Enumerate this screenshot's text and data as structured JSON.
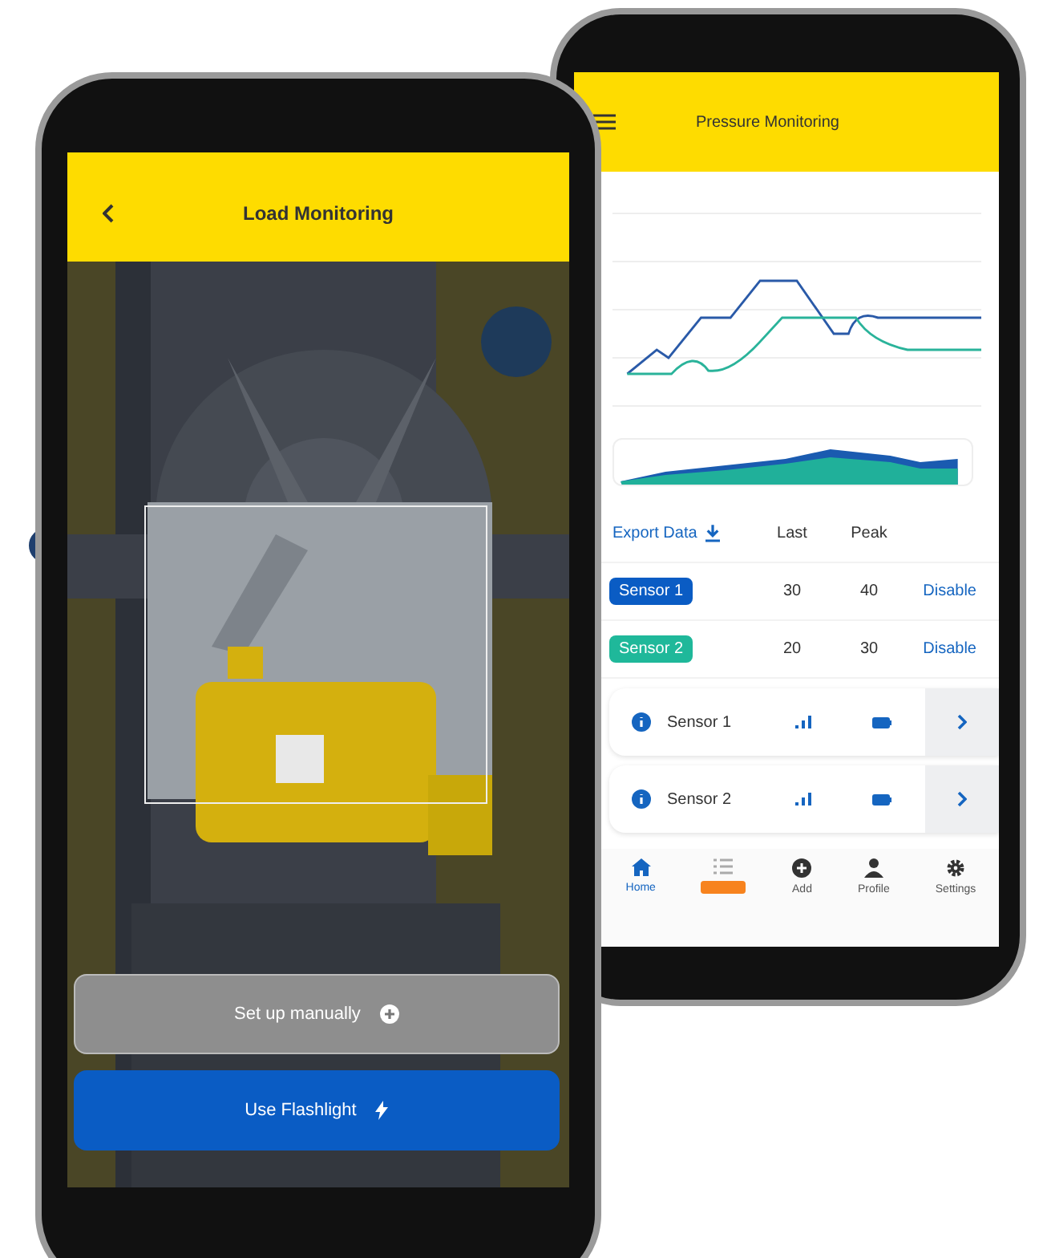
{
  "pressure_screen": {
    "title": "Pressure Monitoring",
    "export_link": "Export Data",
    "columns": [
      "Last",
      "Peak"
    ],
    "sensors": [
      {
        "name": "Sensor 1",
        "color": "#0a5cc4",
        "last": "30",
        "peak": "40",
        "action": "Disable"
      },
      {
        "name": "Sensor 2",
        "color": "#1fb89a",
        "last": "20",
        "peak": "30",
        "action": "Disable"
      }
    ],
    "devices": [
      {
        "name": "Sensor 1"
      },
      {
        "name": "Sensor 2"
      }
    ],
    "nav": [
      {
        "kind": "home",
        "label": "Home",
        "selected": true
      },
      {
        "kind": "list",
        "selected": false
      },
      {
        "kind": "add",
        "label": "Add",
        "selected": false
      },
      {
        "kind": "profile",
        "label": "Profile",
        "selected": false
      },
      {
        "kind": "settings",
        "label": "Settings",
        "selected": false
      }
    ]
  },
  "load_screen": {
    "title": "Load Monitoring",
    "buttons": [
      {
        "kind": "secondary",
        "label": "Set up manually"
      },
      {
        "kind": "primary",
        "label": "Use Flashlight"
      }
    ]
  }
}
